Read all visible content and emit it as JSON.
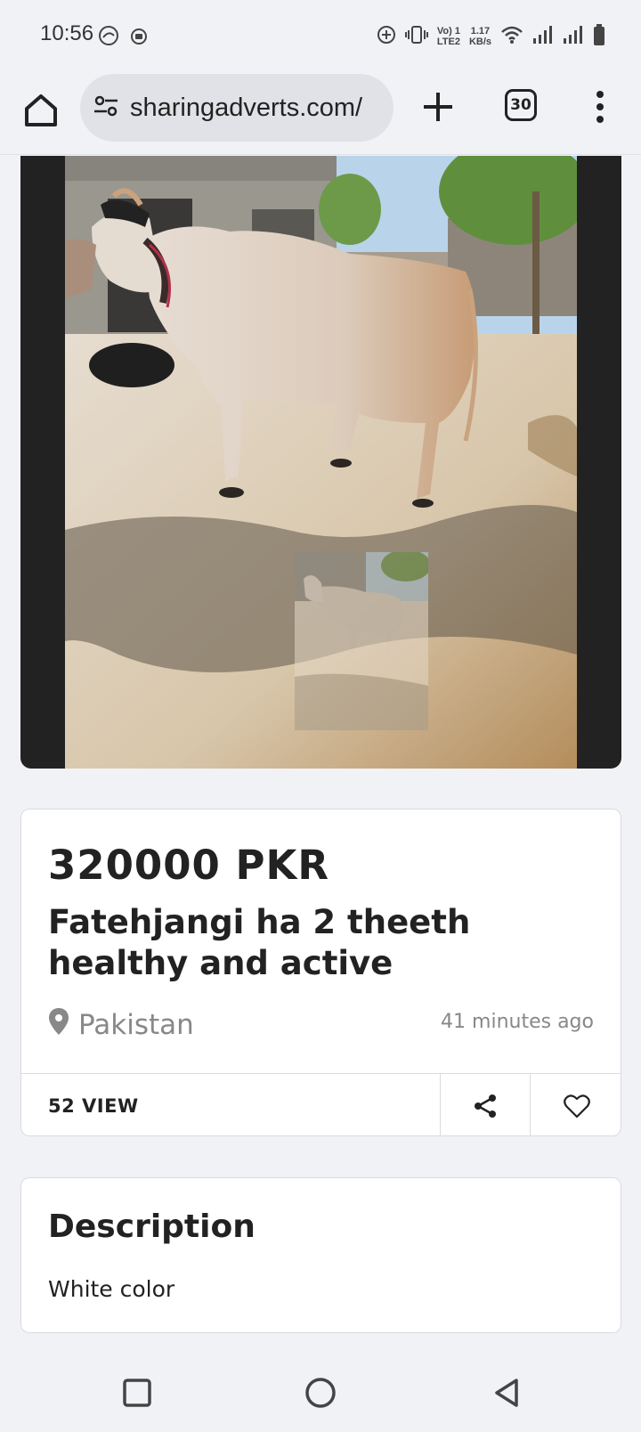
{
  "status_bar": {
    "time": "10:56",
    "net_type_top": "Vo) 1",
    "net_type_bottom": "LTE2",
    "speed_value": "1.17",
    "speed_unit": "KB/s"
  },
  "browser": {
    "url": "sharingadverts.com/",
    "tab_count": "30"
  },
  "listing": {
    "price": "320000 PKR",
    "title": "Fatehjangi ha 2 theeth healthy and active",
    "location": "Pakistan",
    "posted": "41 minutes ago",
    "views": "52 VIEW"
  },
  "description": {
    "heading": "Description",
    "text": "White color"
  },
  "icons": {
    "status": [
      "data-saver-icon",
      "app-notification-icon",
      "add-circle-icon",
      "vibrate-icon",
      "wifi-icon",
      "signal-icon",
      "signal-icon",
      "battery-icon"
    ],
    "toolbar": [
      "home-icon",
      "site-settings-icon",
      "plus-icon",
      "tabs-icon",
      "more-vert-icon"
    ],
    "card": [
      "location-pin-icon",
      "share-icon",
      "heart-icon"
    ],
    "nav": [
      "recents-icon",
      "home-circle-icon",
      "back-icon"
    ]
  }
}
